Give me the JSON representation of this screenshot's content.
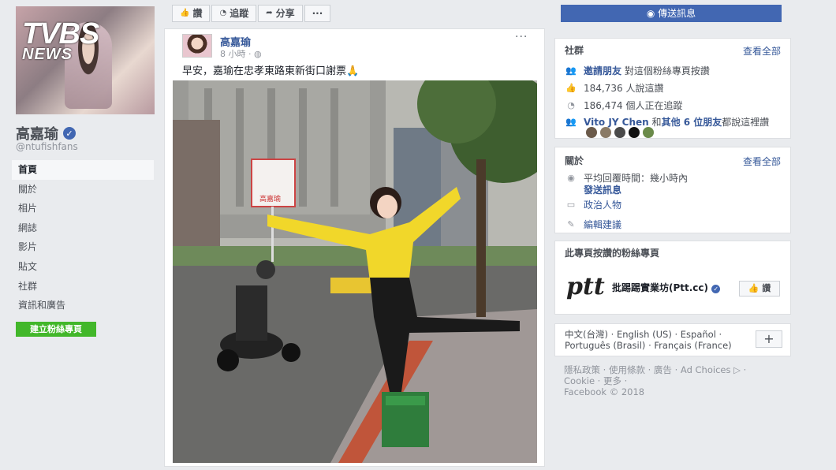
{
  "page": {
    "cover_logo_line1": "TVBS",
    "cover_logo_line2": "NEWS",
    "name": "高嘉瑜",
    "handle": "@ntufishfans",
    "create_page": "建立粉絲專頁"
  },
  "nav": [
    {
      "label": "首頁",
      "active": true
    },
    {
      "label": "關於"
    },
    {
      "label": "相片"
    },
    {
      "label": "網誌"
    },
    {
      "label": "影片"
    },
    {
      "label": "貼文"
    },
    {
      "label": "社群"
    },
    {
      "label": "資訊和廣告"
    }
  ],
  "toolbar": {
    "like": "讚",
    "follow": "追蹤",
    "share": "分享",
    "more": "···",
    "send_message": "傳送訊息"
  },
  "post": {
    "author": "高嘉瑜",
    "time": "8 小時 ·",
    "text": "早安，嘉瑜在忠孝東路東新街口謝票🙏",
    "photo_sign": "高嘉瑜"
  },
  "community": {
    "title": "社群",
    "see_all": "查看全部",
    "invite_link": "邀請朋友",
    "invite_rest": "對這個粉絲專頁按讚",
    "likes": "184,736 人說這讚",
    "follows": "186,474 個人正在追蹤",
    "friends_link": "Vito JY Chen",
    "friends_mid": "和",
    "friends_others": "其他 6 位朋友",
    "friends_rest": "都說這裡讚"
  },
  "about": {
    "title": "關於",
    "see_all": "查看全部",
    "response": "平均回覆時間：幾小時內",
    "send_message": "發送訊息",
    "category": "政治人物",
    "edit": "編輯建議"
  },
  "liked_pages": {
    "title": "此專頁按讚的粉絲專頁",
    "page_name": "批踢踢實業坊(Ptt.cc)",
    "like_button": "讚",
    "logo_text": "ptt"
  },
  "languages": {
    "line1": "中文(台灣) · English (US) · Español ·",
    "line2": "Português (Brasil) · Français (France)",
    "plus": "+"
  },
  "footer": {
    "line1": "隱私政策 · 使用條款 · 廣告 · Ad Choices ▷ ·",
    "line2": "Cookie · 更多 ·",
    "line3": "Facebook © 2018"
  },
  "colors": {
    "brand": "#4267b2",
    "link": "#365899",
    "create_green": "#42b72a"
  }
}
